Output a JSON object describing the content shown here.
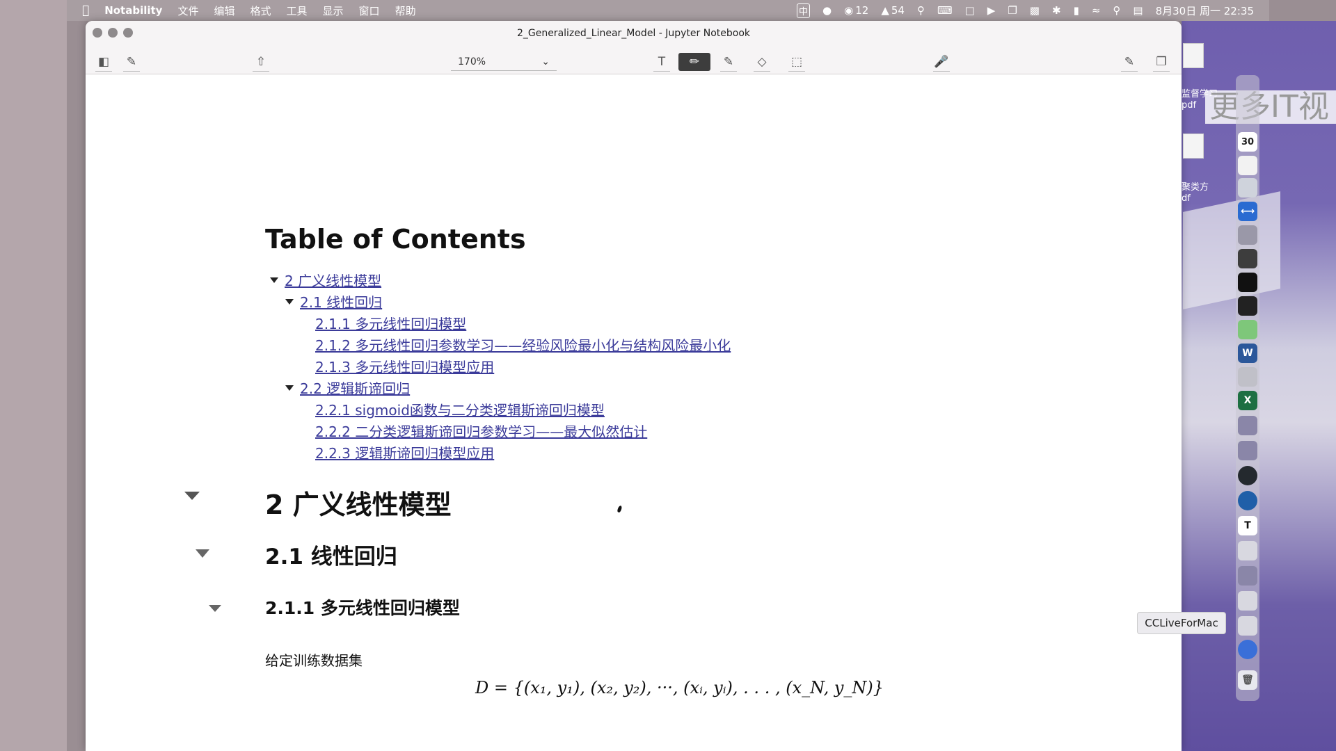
{
  "menubar": {
    "app_name": "Notability",
    "menus": [
      "文件",
      "编辑",
      "格式",
      "工具",
      "显示",
      "窗口",
      "帮助"
    ],
    "ime": "中",
    "wechat_count": "12",
    "qq_count": "54",
    "datetime": "8月30日 周一  22:35"
  },
  "window": {
    "title": "2_Generalized_Linear_Model - Jupyter Notebook",
    "zoom": "170%"
  },
  "toc": {
    "title": "Table of Contents",
    "items": [
      {
        "label": "2 广义线性模型",
        "level": 1,
        "collapsible": true
      },
      {
        "label": "2.1 线性回归",
        "level": 2,
        "collapsible": true
      },
      {
        "label": "2.1.1 多元线性回归模型",
        "level": 3,
        "collapsible": false
      },
      {
        "label": "2.1.2 多元线性回归参数学习——经验风险最小化与结构风险最小化",
        "level": 3,
        "collapsible": false
      },
      {
        "label": "2.1.3 多元线性回归模型应用",
        "level": 3,
        "collapsible": false
      },
      {
        "label": "2.2 逻辑斯谛回归",
        "level": 2,
        "collapsible": true
      },
      {
        "label": "2.2.1 sigmoid函数与二分类逻辑斯谛回归模型",
        "level": 3,
        "collapsible": false
      },
      {
        "label": "2.2.2 二分类逻辑斯谛回归参数学习——最大似然估计",
        "level": 3,
        "collapsible": false
      },
      {
        "label": "2.2.3 逻辑斯谛回归模型应用",
        "level": 3,
        "collapsible": false
      }
    ]
  },
  "notebook": {
    "h2": "2 广义线性模型",
    "h3": "2.1 线性回归",
    "h4": "2.1.1 多元线性回归模型",
    "paragraph": "给定训练数据集",
    "formula": "D = {(x₁, y₁), (x₂, y₂), ···, (xᵢ, yᵢ), . . . , (x_N, y_N)}"
  },
  "desktop": {
    "watermark": "更多IT视",
    "file1_label_a": "监督学习",
    "file1_label_b": "pdf",
    "file2_label_a": "聚类方",
    "file2_label_b": "df",
    "tooltip": "CCLiveForMac",
    "dock_badge": "30"
  },
  "colors": {
    "link": "#3b3b9a",
    "menubar": "#a89ea2",
    "desktop": "#7668b3"
  }
}
